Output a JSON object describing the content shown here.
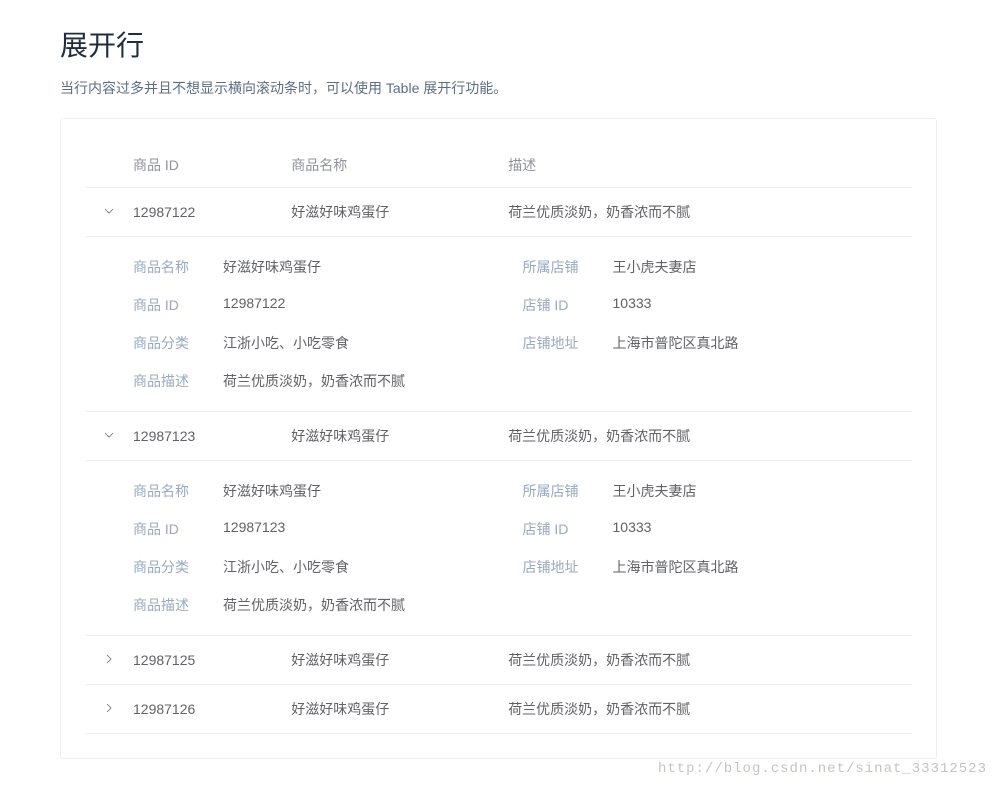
{
  "page": {
    "title": "展开行",
    "description": "当行内容过多并且不想显示横向滚动条时，可以使用 Table 展开行功能。"
  },
  "table": {
    "headers": {
      "id": "商品 ID",
      "name": "商品名称",
      "desc": "描述"
    },
    "rows": [
      {
        "expanded": true,
        "id": "12987122",
        "name": "好滋好味鸡蛋仔",
        "desc": "荷兰优质淡奶，奶香浓而不腻",
        "details": {
          "productName": "好滋好味鸡蛋仔",
          "shop": "王小虎夫妻店",
          "productId": "12987122",
          "shopId": "10333",
          "category": "江浙小吃、小吃零食",
          "address": "上海市普陀区真北路",
          "description": "荷兰优质淡奶，奶香浓而不腻"
        }
      },
      {
        "expanded": true,
        "id": "12987123",
        "name": "好滋好味鸡蛋仔",
        "desc": "荷兰优质淡奶，奶香浓而不腻",
        "details": {
          "productName": "好滋好味鸡蛋仔",
          "shop": "王小虎夫妻店",
          "productId": "12987123",
          "shopId": "10333",
          "category": "江浙小吃、小吃零食",
          "address": "上海市普陀区真北路",
          "description": "荷兰优质淡奶，奶香浓而不腻"
        }
      },
      {
        "expanded": false,
        "id": "12987125",
        "name": "好滋好味鸡蛋仔",
        "desc": "荷兰优质淡奶，奶香浓而不腻"
      },
      {
        "expanded": false,
        "id": "12987126",
        "name": "好滋好味鸡蛋仔",
        "desc": "荷兰优质淡奶，奶香浓而不腻"
      }
    ]
  },
  "labels": {
    "productName": "商品名称",
    "shop": "所属店铺",
    "productId": "商品 ID",
    "shopId": "店铺 ID",
    "category": "商品分类",
    "address": "店铺地址",
    "description": "商品描述"
  },
  "watermark": "http://blog.csdn.net/sinat_33312523"
}
